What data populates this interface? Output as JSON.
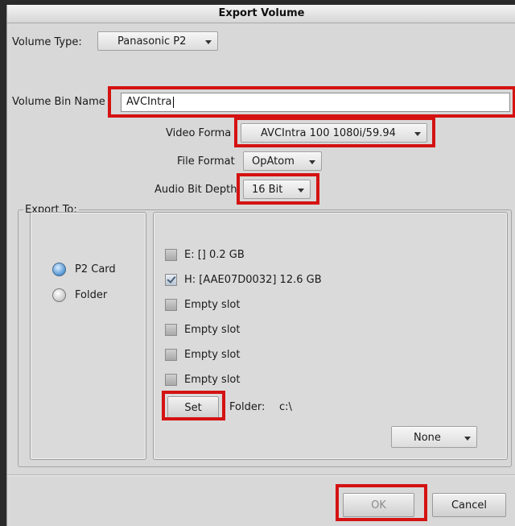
{
  "dialog": {
    "title": "Export Volume"
  },
  "volume_type": {
    "label": "Volume Type:",
    "value": "Panasonic P2"
  },
  "bin_name": {
    "label": "Volume Bin Name",
    "value": "AVCIntra"
  },
  "video_format": {
    "label": "Video Forma",
    "value": "AVCIntra 100 1080i/59.94"
  },
  "file_format": {
    "label": "File Format",
    "value": "OpAtom"
  },
  "audio_bit_depth": {
    "label": "Audio Bit Depth",
    "value": "16 Bit"
  },
  "export_to": {
    "legend": "Export To:",
    "options": [
      {
        "label": "P2 Card",
        "selected": true
      },
      {
        "label": "Folder",
        "selected": false
      }
    ],
    "slots": [
      {
        "label": "E: [] 0.2 GB",
        "checked": false
      },
      {
        "label": "H: [AAE07D0032] 12.6 GB",
        "checked": true
      },
      {
        "label": "Empty slot",
        "checked": false
      },
      {
        "label": "Empty slot",
        "checked": false
      },
      {
        "label": "Empty slot",
        "checked": false
      },
      {
        "label": "Empty slot",
        "checked": false
      }
    ],
    "set_button": "Set",
    "folder_label": "Folder:",
    "folder_value": "c:\\",
    "none_dropdown": "None"
  },
  "footer": {
    "ok": "OK",
    "cancel": "Cancel"
  },
  "colors": {
    "highlight": "#d41212",
    "selected_radio": "#5d9bd6"
  }
}
